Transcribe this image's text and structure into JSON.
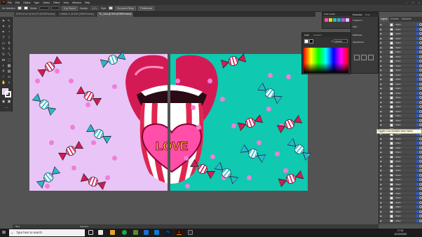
{
  "menu": {
    "logo": "Ai",
    "items": [
      "File",
      "Edit",
      "Object",
      "Type",
      "Select",
      "Effect",
      "View",
      "Window",
      "Help"
    ]
  },
  "control": {
    "selection_label": "No Selection",
    "stroke_label": "Stroke:",
    "stroke_value": "",
    "brush_label": "5 pt. Round",
    "opacity_label": "Opacity:",
    "opacity_value": "100%",
    "style_label": "Style:",
    "doc_setup": "Document Setup",
    "preferences": "Preferences"
  },
  "tabs": [
    {
      "label": "DISPLAY.ai* @ 66.67% (RGB/Preview)"
    },
    {
      "label": "Untitled-1* @ 50% (RGB/Preview)"
    },
    {
      "label": "FO_18.ai @ 50% (RGB/Preview)"
    }
  ],
  "panels": {
    "color_guide_title": "Color Guide",
    "color_title": "Color",
    "color_tab2": "Gradient",
    "hex_label": "#",
    "hex_value": "000000",
    "props_tabs": [
      "Properties",
      "Links"
    ],
    "props_labels": [
      "Transform",
      "Align",
      "Pathfinder"
    ],
    "appearance": "Appearance"
  },
  "layers": {
    "tabs": [
      "Layers",
      "Libraries",
      "Artboards"
    ],
    "row_label": "<Path>",
    "row_count": 44
  },
  "tooltip": "Toggles Lock (editable when blank)",
  "status": {
    "zoom": "50%",
    "mode": "Selection"
  },
  "taskbar": {
    "search_placeholder": "Type here to search",
    "time": "17:01",
    "date": "12/12/2020"
  },
  "artwork": {
    "heart_text": "LOVE",
    "colors": {
      "lilac_bg": "#e8c5f6",
      "teal_bg": "#0fc9b0",
      "lip_red": "#d41a55",
      "heart_pink": "#ff4fa8",
      "love_yellow": "#ffd21e"
    }
  }
}
